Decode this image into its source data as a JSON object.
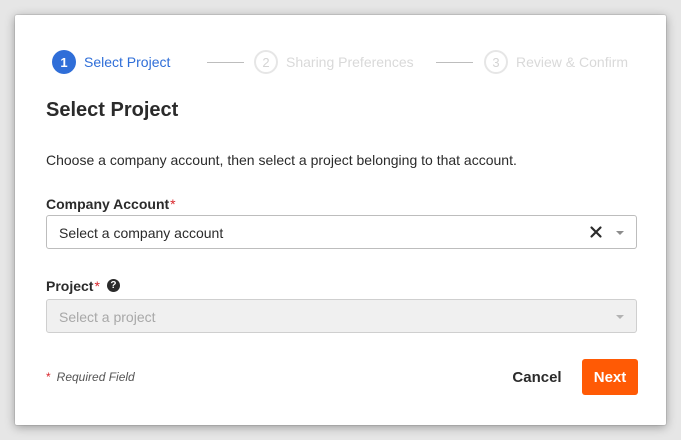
{
  "stepper": {
    "steps": [
      {
        "number": "1",
        "label": "Select Project",
        "state": "active"
      },
      {
        "number": "2",
        "label": "Sharing Preferences",
        "state": "inactive"
      },
      {
        "number": "3",
        "label": "Review & Confirm",
        "state": "inactive"
      }
    ]
  },
  "page": {
    "title": "Select Project",
    "description": "Choose a company account, then select a project belonging to that account."
  },
  "company_account": {
    "label": "Company Account",
    "required_mark": "*",
    "value": "Select a company account",
    "clear_icon": "close-icon",
    "dropdown_icon": "caret-down-icon"
  },
  "project": {
    "label": "Project",
    "required_mark": "*",
    "help_icon": "question-circle-icon",
    "help_glyph": "?",
    "placeholder": "Select a project",
    "disabled": true,
    "dropdown_icon": "caret-down-icon"
  },
  "footer": {
    "required_mark": "*",
    "required_note": "Required Field",
    "cancel_label": "Cancel",
    "next_label": "Next"
  },
  "colors": {
    "accent": "#2f6ed8",
    "primary_button": "#ff5a05",
    "required": "#d9262c"
  }
}
